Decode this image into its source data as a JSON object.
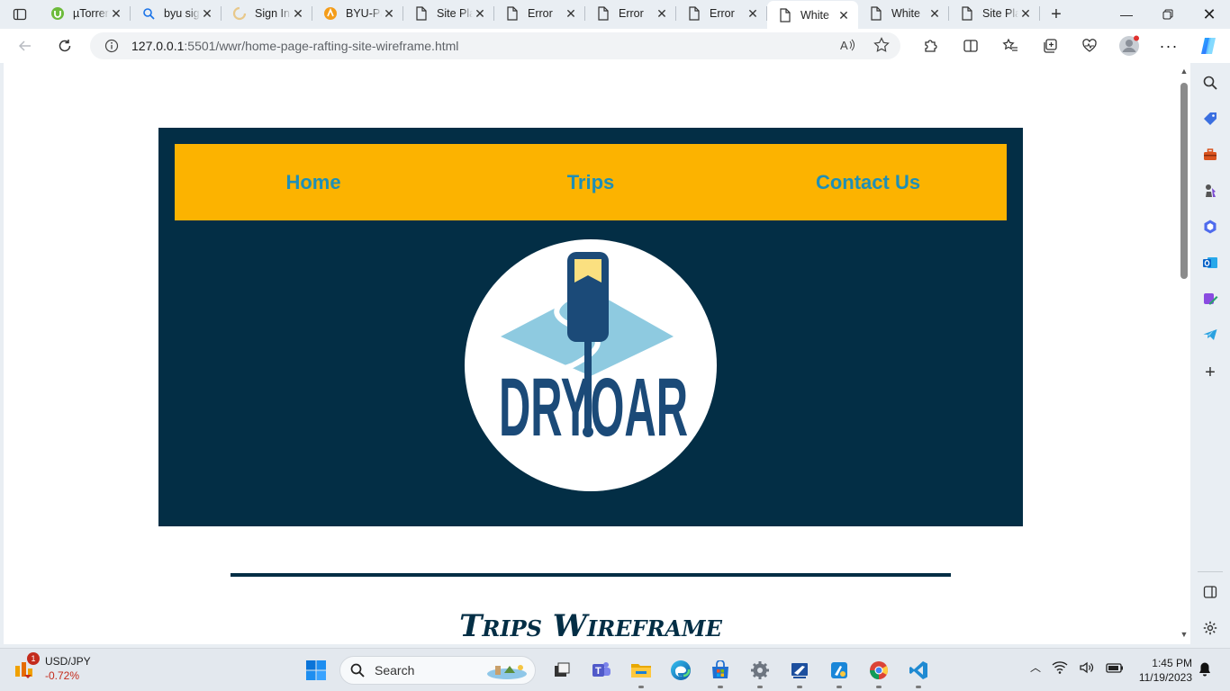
{
  "browser": {
    "tabs": [
      {
        "title": "µTorrent",
        "icon": "utorrent-icon",
        "active": false
      },
      {
        "title": "byu sign",
        "icon": "search-icon",
        "active": false
      },
      {
        "title": "Sign In",
        "icon": "loading-icon",
        "active": false
      },
      {
        "title": "BYU-Pa",
        "icon": "byu-icon",
        "active": false
      },
      {
        "title": "Site Pla",
        "icon": "page-icon",
        "active": false
      },
      {
        "title": "Error",
        "icon": "page-icon",
        "active": false
      },
      {
        "title": "Error",
        "icon": "page-icon",
        "active": false
      },
      {
        "title": "Error",
        "icon": "page-icon",
        "active": false
      },
      {
        "title": "White",
        "icon": "page-icon",
        "active": true
      },
      {
        "title": "White",
        "icon": "page-icon",
        "active": false
      },
      {
        "title": "Site Pla",
        "icon": "page-icon",
        "active": false
      }
    ],
    "address": {
      "host": "127.0.0.1",
      "path": ":5501/wwr/home-page-rafting-site-wireframe.html"
    }
  },
  "page": {
    "nav": {
      "home": "Home",
      "trips": "Trips",
      "contact": "Contact Us"
    },
    "logo_text": "DRYOAR",
    "section_title": "Trips Wireframe",
    "colors": {
      "hero_bg": "#032e45",
      "nav_bg": "#fcb300",
      "nav_link": "#1e8fb7"
    }
  },
  "taskbar": {
    "widget": {
      "label": "USD/JPY",
      "change": "-0.72%",
      "badge": "1"
    },
    "search_placeholder": "Search",
    "time": "1:45 PM",
    "date": "11/19/2023"
  }
}
